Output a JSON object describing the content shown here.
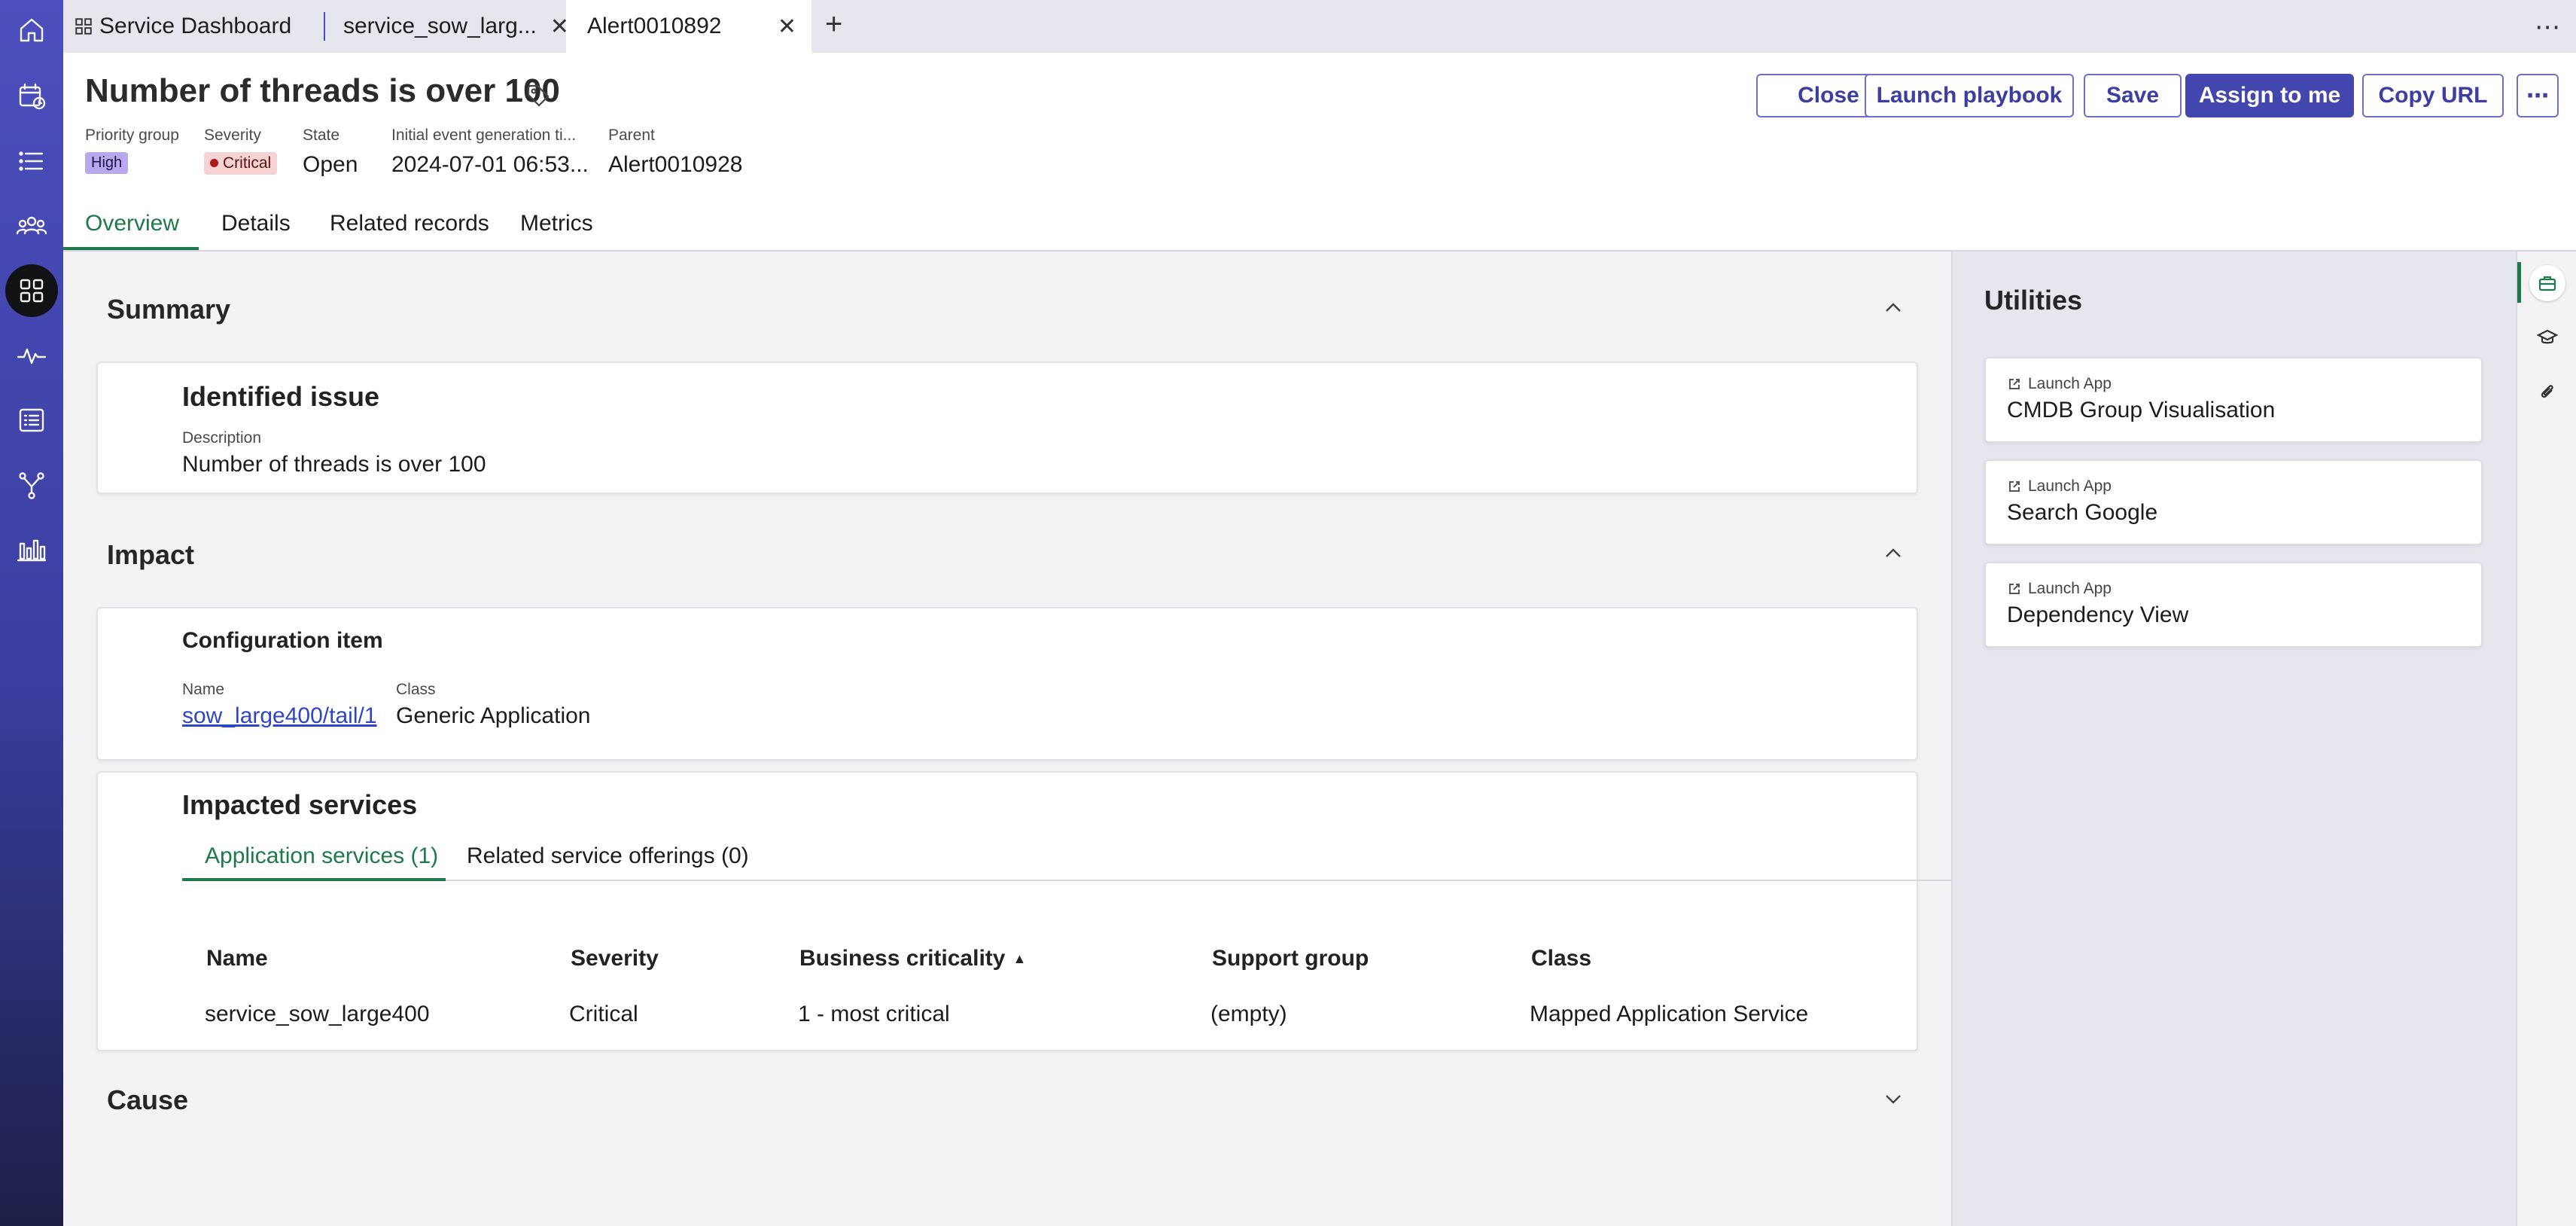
{
  "tabs": [
    {
      "label": "Service Dashboard"
    },
    {
      "label": "service_sow_larg..."
    },
    {
      "label": "Alert0010892"
    }
  ],
  "header": {
    "title": "Number of threads is over 100",
    "fields": {
      "priority_group": {
        "label": "Priority group",
        "value": "High"
      },
      "severity": {
        "label": "Severity",
        "value": "Critical"
      },
      "state": {
        "label": "State",
        "value": "Open"
      },
      "initial_event": {
        "label": "Initial event generation ti...",
        "value": "2024-07-01 06:53..."
      },
      "parent": {
        "label": "Parent",
        "value": "Alert0010928"
      }
    },
    "buttons": {
      "close": "Close",
      "launch_playbook": "Launch playbook",
      "save": "Save",
      "assign": "Assign to me",
      "copy_url": "Copy URL",
      "more": "⋯"
    }
  },
  "record_tabs": [
    "Overview",
    "Details",
    "Related records",
    "Metrics"
  ],
  "summary": {
    "title": "Summary",
    "card_title": "Identified issue",
    "description_label": "Description",
    "description": "Number of threads is over 100"
  },
  "impact": {
    "title": "Impact",
    "ci": {
      "title": "Configuration item",
      "name_label": "Name",
      "name": "sow_large400/tail/1",
      "class_label": "Class",
      "class": "Generic Application"
    },
    "impacted": {
      "title": "Impacted services",
      "sub_tabs": [
        "Application services (1)",
        "Related service offerings (0)"
      ],
      "columns": [
        "Name",
        "Severity",
        "Business criticality",
        "Support group",
        "Class"
      ],
      "rows": [
        [
          "service_sow_large400",
          "Critical",
          "1 - most critical",
          "(empty)",
          "Mapped Application Service"
        ]
      ]
    }
  },
  "cause": {
    "title": "Cause"
  },
  "utilities": {
    "title": "Utilities",
    "items": [
      {
        "small": "Launch App",
        "label": "CMDB Group Visualisation"
      },
      {
        "small": "Launch App",
        "label": "Search Google"
      },
      {
        "small": "Launch App",
        "label": "Dependency View"
      }
    ]
  },
  "colors": {
    "accent": "#4346ac",
    "active_tab": "#1e7a4a",
    "link": "#2f45c3"
  }
}
